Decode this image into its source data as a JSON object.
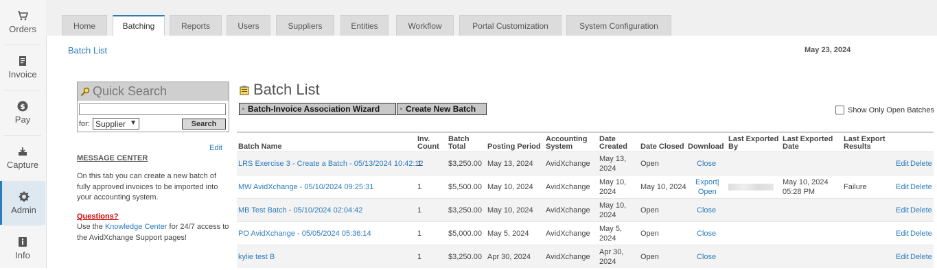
{
  "leftnav": {
    "items": [
      {
        "label": "Orders",
        "icon": "cart-icon"
      },
      {
        "label": "Invoice",
        "icon": "invoice-icon"
      },
      {
        "label": "Pay",
        "icon": "dollar-icon"
      },
      {
        "label": "Capture",
        "icon": "capture-icon"
      },
      {
        "label": "Admin",
        "icon": "gear-icon",
        "active": true
      },
      {
        "label": "Info",
        "icon": "info-icon"
      }
    ]
  },
  "tabs": [
    "Home",
    "Batching",
    "Reports",
    "Users",
    "Suppliers",
    "Entities",
    "Workflow",
    "Portal Customization",
    "System Configuration"
  ],
  "active_tab": "Batching",
  "breadcrumb": "Batch List",
  "date": "May 23, 2024",
  "quick_search": {
    "title": "Quick Search",
    "input_value": "",
    "for_label": "for:",
    "select_value": "Supplier",
    "button": "Search"
  },
  "message_center": {
    "edit": "Edit",
    "title": "MESSAGE CENTER",
    "text": "On this tab you can create a new batch of fully approved invoices to be imported into your accounting system.",
    "questions": "Questions?",
    "q_prefix": "Use the ",
    "q_link": "Knowledge Center",
    "q_suffix": " for 24/7 access to the AvidXchange Support pages!"
  },
  "batch_list": {
    "title": "Batch List",
    "wizard_button": "Batch-Invoice Association Wizard",
    "create_button": "Create New Batch",
    "show_open_label": "Show Only Open Batches",
    "columns": {
      "batch_name": "Batch Name",
      "inv_count_1": "Inv.",
      "inv_count_2": "Count",
      "batch_total_1": "Batch",
      "batch_total_2": "Total",
      "posting_period": "Posting Period",
      "accounting_1": "Accounting",
      "accounting_2": "System",
      "date_created_1": "Date",
      "date_created_2": "Created",
      "date_closed": "Date Closed",
      "download": "Download",
      "last_exported_by_1": "Last Exported",
      "last_exported_by_2": "By",
      "last_exported_date_1": "Last Exported",
      "last_exported_date_2": "Date",
      "last_export_results_1": "Last Export",
      "last_export_results_2": "Results"
    },
    "rows": [
      {
        "name": "LRS Exercise 3 - Create a Batch - 05/13/2024 10:42:12",
        "count": "1",
        "total": "$3,250.00",
        "period": "May 13, 2024",
        "system": "AvidXchange",
        "created_1": "May 13,",
        "created_2": "2024",
        "closed": "Open",
        "download_1": "Close",
        "download_2": "",
        "exported_by": "",
        "exported_date_1": "",
        "exported_date_2": "",
        "results": "",
        "edit": "Edit",
        "delete": "Delete"
      },
      {
        "name": "MW AvidXchange - 05/10/2024 09:25:31",
        "count": "1",
        "total": "$5,500.00",
        "period": "May 10, 2024",
        "system": "AvidXchange",
        "created_1": "May 10,",
        "created_2": "2024",
        "closed": "May 10, 2024",
        "download_1": "Export|",
        "download_2": "Open",
        "exported_by": "blurred",
        "exported_date_1": "May 10, 2024",
        "exported_date_2": "05:28 PM",
        "results": "Failure",
        "edit": "Edit",
        "delete": "Delete"
      },
      {
        "name": "MB Test Batch - 05/10/2024 02:04:42",
        "count": "1",
        "total": "$3,250.00",
        "period": "May 10, 2024",
        "system": "AvidXchange",
        "created_1": "May 10,",
        "created_2": "2024",
        "closed": "Open",
        "download_1": "Close",
        "download_2": "",
        "exported_by": "",
        "exported_date_1": "",
        "exported_date_2": "",
        "results": "",
        "edit": "Edit",
        "delete": "Delete"
      },
      {
        "name": "PO AvidXchange - 05/05/2024 05:36:14",
        "count": "1",
        "total": "$5,000.00",
        "period": "May 5, 2024",
        "system": "AvidXchange",
        "created_1": "May 5,",
        "created_2": "2024",
        "closed": "Open",
        "download_1": "Close",
        "download_2": "",
        "exported_by": "",
        "exported_date_1": "",
        "exported_date_2": "",
        "results": "",
        "edit": "Edit",
        "delete": "Delete"
      },
      {
        "name": "kylie test B",
        "count": "1",
        "total": "$3,250.00",
        "period": "Apr 30, 2024",
        "system": "AvidXchange",
        "created_1": "Apr 30,",
        "created_2": "2024",
        "closed": "Open",
        "download_1": "Close",
        "download_2": "",
        "exported_by": "",
        "exported_date_1": "",
        "exported_date_2": "",
        "results": "",
        "edit": "Edit",
        "delete": "Delete"
      }
    ]
  }
}
